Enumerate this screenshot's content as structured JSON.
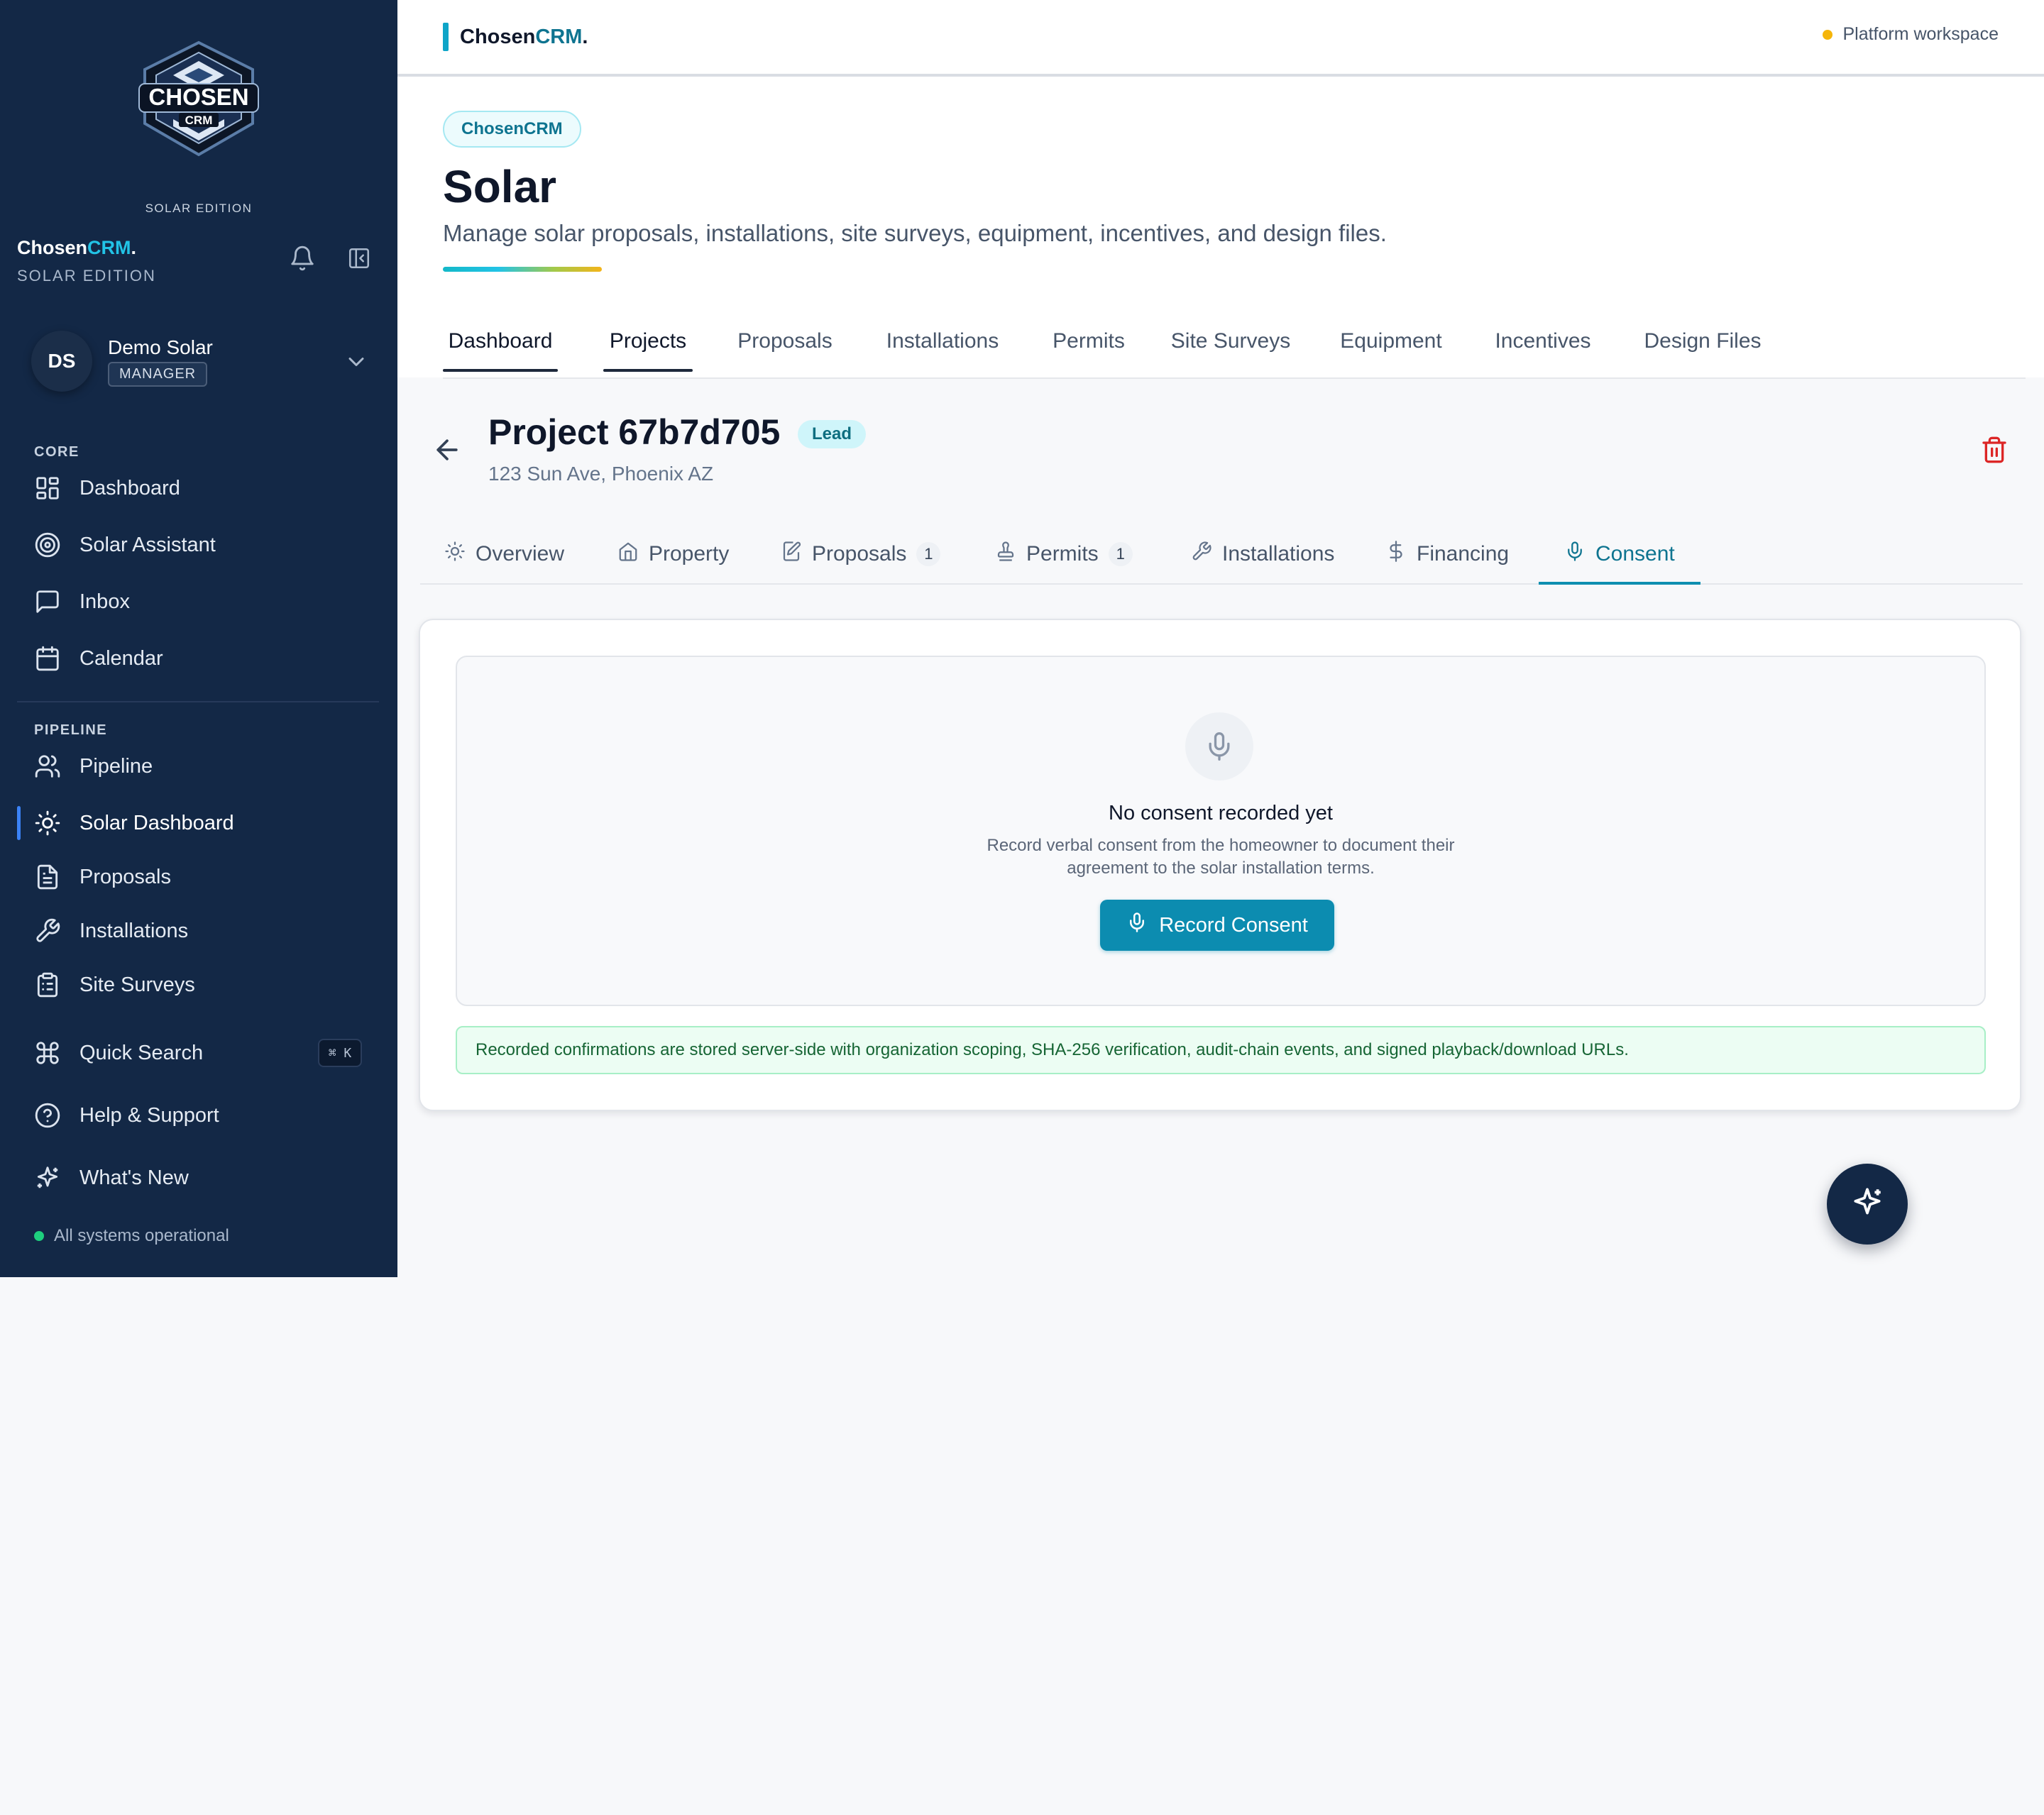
{
  "sidebar": {
    "logo_text": "CHOSEN",
    "logo_subtext": "CRM",
    "edition_small": "SOLAR EDITION",
    "brand_prefix": "Chosen",
    "brand_accent": "CRM",
    "brand_dot": ".",
    "brand_edition": "SOLAR EDITION",
    "user": {
      "initials": "DS",
      "name": "Demo Solar",
      "role": "MANAGER"
    },
    "sections": {
      "core": "CORE",
      "pipeline": "PIPELINE"
    },
    "core_items": [
      {
        "label": "Dashboard",
        "icon": "grid-icon"
      },
      {
        "label": "Solar Assistant",
        "icon": "target-icon"
      },
      {
        "label": "Inbox",
        "icon": "chat-icon"
      },
      {
        "label": "Calendar",
        "icon": "calendar-icon"
      }
    ],
    "pipeline_items": [
      {
        "label": "Pipeline",
        "icon": "users-icon"
      },
      {
        "label": "Solar Dashboard",
        "icon": "sun-icon",
        "active": true
      },
      {
        "label": "Proposals",
        "icon": "document-icon"
      },
      {
        "label": "Installations",
        "icon": "wrench-icon"
      },
      {
        "label": "Site Surveys",
        "icon": "clipboard-icon"
      }
    ],
    "utility_items": [
      {
        "label": "Quick Search",
        "icon": "command-icon",
        "shortcut": "⌘ K"
      },
      {
        "label": "Help & Support",
        "icon": "help-icon"
      },
      {
        "label": "What's New",
        "icon": "sparkles-icon"
      }
    ],
    "status": "All systems operational"
  },
  "topbar": {
    "brand_prefix": "Chosen",
    "brand_accent": "CRM",
    "brand_dot": ".",
    "workspace": "Platform workspace"
  },
  "header": {
    "pill": "ChosenCRM",
    "title": "Solar",
    "subtitle": "Manage solar proposals, installations, site surveys, equipment, incentives, and design files.",
    "tabs": [
      "Dashboard",
      "Projects",
      "Proposals",
      "Installations",
      "Permits",
      "Site Surveys",
      "Equipment",
      "Incentives",
      "Design Files"
    ]
  },
  "project": {
    "title": "Project 67b7d705",
    "status": "Lead",
    "address": "123 Sun Ave, Phoenix AZ",
    "tabs": [
      {
        "label": "Overview",
        "icon": "sun-icon"
      },
      {
        "label": "Property",
        "icon": "home-icon"
      },
      {
        "label": "Proposals",
        "icon": "edit-document-icon",
        "count": "1"
      },
      {
        "label": "Permits",
        "icon": "stamp-icon",
        "count": "1"
      },
      {
        "label": "Installations",
        "icon": "wrench-icon"
      },
      {
        "label": "Financing",
        "icon": "dollar-icon"
      },
      {
        "label": "Consent",
        "icon": "mic-icon",
        "active": true
      }
    ]
  },
  "consent": {
    "empty_title": "No consent recorded yet",
    "empty_desc_line1": "Record verbal consent from the homeowner to document their",
    "empty_desc_line2": "agreement to the solar installation terms.",
    "record_button": "Record Consent",
    "notice": "Recorded confirmations are stored server-side with organization scoping, SHA-256 verification, audit-chain events, and signed playback/download URLs."
  },
  "colors": {
    "sidebar_bg": "#132846",
    "accent": "#0c8cb0",
    "brand_accent": "#22c3e6",
    "danger": "#dc2626"
  }
}
